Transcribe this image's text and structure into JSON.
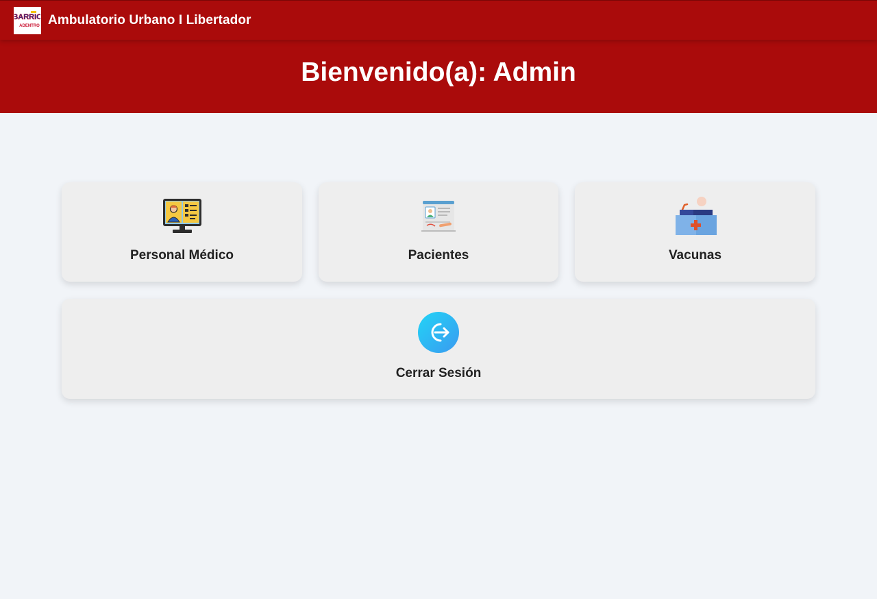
{
  "navbar": {
    "logo_text_top": "BARRIO",
    "logo_text_bottom": "ADENTRO",
    "title": "Ambulatorio Urbano I Libertador"
  },
  "hero": {
    "welcome": "Bienvenido(a): Admin"
  },
  "cards": [
    {
      "label": "Personal Médico",
      "icon": "doctor-monitor-icon"
    },
    {
      "label": "Pacientes",
      "icon": "patient-record-icon"
    },
    {
      "label": "Vacunas",
      "icon": "vaccine-kit-icon"
    },
    {
      "label": "Cerrar Sesión",
      "icon": "logout-icon"
    }
  ],
  "colors": {
    "header_red": "#aa0b0b",
    "page_background": "#f1f4f8",
    "card_background": "#eeeeee",
    "logout_cyan": "#1ec8f0"
  }
}
